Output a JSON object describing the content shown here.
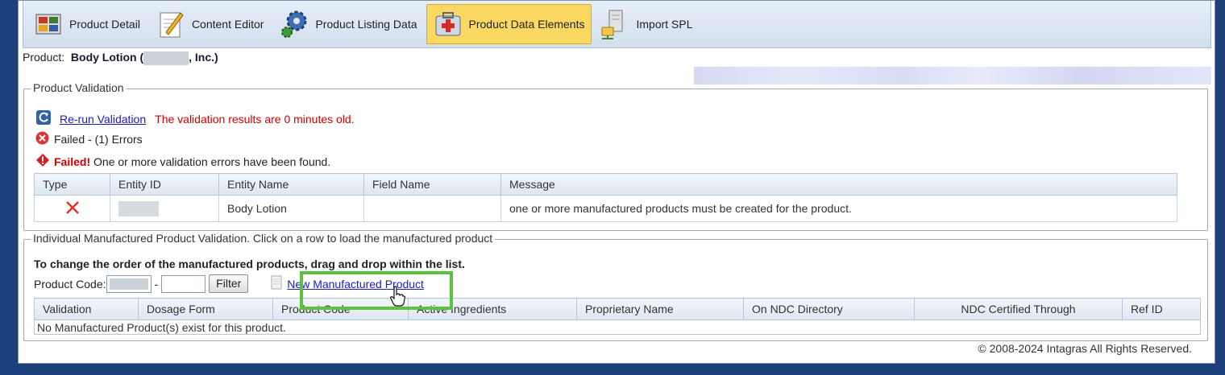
{
  "toolbar": {
    "tabs": [
      {
        "label": "Product Detail",
        "icon": "product-detail-icon"
      },
      {
        "label": "Content Editor",
        "icon": "content-editor-icon"
      },
      {
        "label": "Product Listing Data",
        "icon": "gears-icon"
      },
      {
        "label": "Product Data Elements",
        "icon": "first-aid-kit-icon"
      },
      {
        "label": "Import SPL",
        "icon": "import-server-icon"
      }
    ],
    "active_index": 3
  },
  "product": {
    "label": "Product:",
    "name_start": "Body Lotion (",
    "name_end": ", Inc.)"
  },
  "validation": {
    "legend": "Product Validation",
    "rerun_label": "Re-run Validation",
    "age_text": "The validation results are 0 minutes old.",
    "failed_summary": "Failed - (1) Errors",
    "failed_label": "Failed!",
    "failed_text": "One or more validation errors have been found.",
    "table": {
      "headers": [
        "Type",
        "Entity ID",
        "Entity Name",
        "Field Name",
        "Message"
      ],
      "rows": [
        {
          "entity_name": "Body Lotion",
          "field_name": "",
          "message": "one or more manufactured products must be created for the product."
        }
      ]
    }
  },
  "manufactured": {
    "legend": "Individual Manufactured Product Validation. Click on a row to load the manufactured product",
    "instruction": "To change the order of the manufactured products, drag and drop within the list.",
    "product_code_label": "Product Code:",
    "dash": "-",
    "filter_label": "Filter",
    "new_label": "New Manufactured Product",
    "table": {
      "headers": [
        "Validation",
        "Dosage Form",
        "Product Code",
        "Active Ingredients",
        "Proprietary Name",
        "On NDC Directory",
        "NDC Certified Through",
        "Ref ID"
      ],
      "empty_text": "No Manufactured Product(s) exist for this product."
    }
  },
  "footer": {
    "copyright": "© 2008-2024 Intagras All Rights Reserved."
  },
  "colors": {
    "accent_link": "#1a1acc",
    "error_red": "#d00000",
    "active_tab": "#fbd862",
    "highlight_green": "#5bc23c"
  }
}
